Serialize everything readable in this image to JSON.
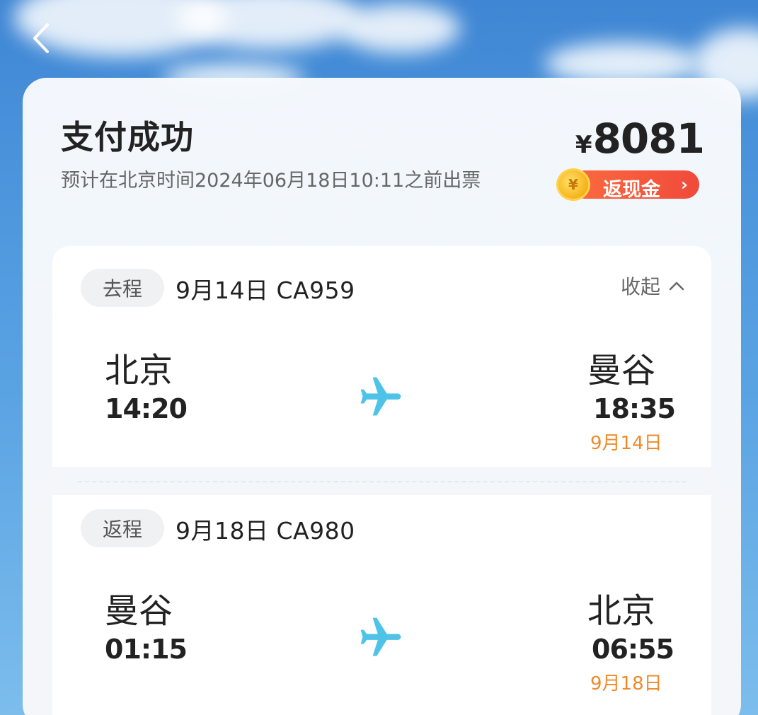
{
  "header": {
    "title": "支付成功",
    "subtitle": "预计在北京时间2024年06月18日10:11之前出票",
    "price_currency": "¥",
    "price_amount": "8081",
    "cashback_label": "返现金",
    "cashback_arrow": "›"
  },
  "colors": {
    "accent_orange": "#ef8a2a",
    "cashback_red": "#f04a3b",
    "plane_blue": "#4dc3e8"
  },
  "outbound": {
    "tag": "去程",
    "flight": "9月14日 CA959",
    "collapse_label": "收起",
    "depart_city": "北京",
    "depart_time": "14:20",
    "arrive_city": "曼谷",
    "arrive_time": "18:35",
    "arrive_date": "9月14日"
  },
  "inbound": {
    "tag": "返程",
    "flight": "9月18日 CA980",
    "depart_city": "曼谷",
    "depart_time": "01:15",
    "arrive_city": "北京",
    "arrive_time": "06:55",
    "arrive_date": "9月18日"
  },
  "icons": {
    "back": "chevron-left-icon",
    "plane": "airplane-icon",
    "collapse": "chevron-up-icon",
    "coin": "coin-icon"
  }
}
